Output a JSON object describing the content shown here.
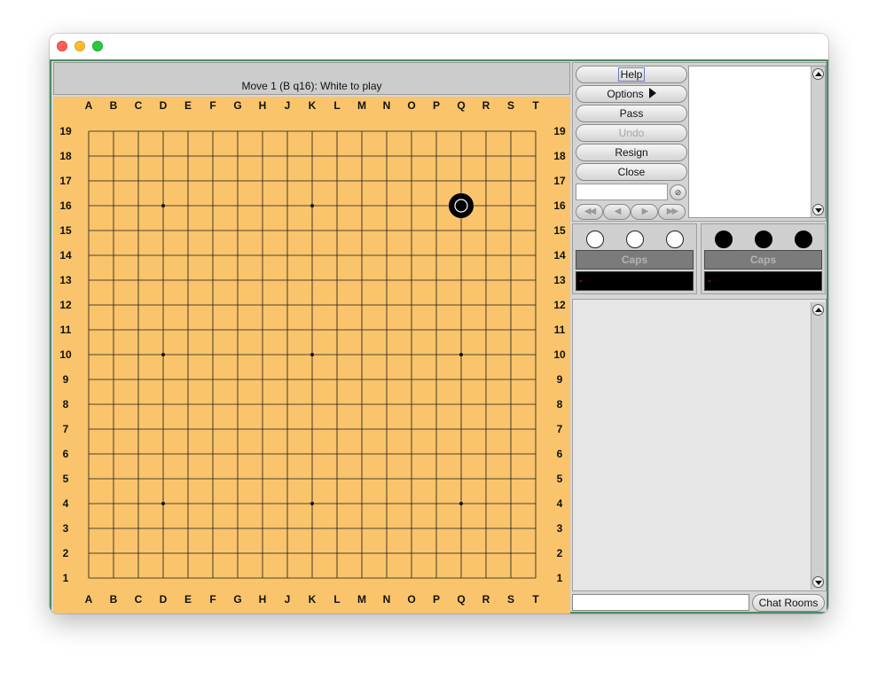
{
  "status": {
    "text": "Move 1 (B q16): White to play"
  },
  "board": {
    "size": 19,
    "columns": [
      "A",
      "B",
      "C",
      "D",
      "E",
      "F",
      "G",
      "H",
      "J",
      "K",
      "L",
      "M",
      "N",
      "O",
      "P",
      "Q",
      "R",
      "S",
      "T"
    ],
    "rows": [
      "19",
      "18",
      "17",
      "16",
      "15",
      "14",
      "13",
      "12",
      "11",
      "10",
      "9",
      "8",
      "7",
      "6",
      "5",
      "4",
      "3",
      "2",
      "1"
    ],
    "background_color": "#f9c46b",
    "star_points": [
      "D16",
      "K16",
      "Q16",
      "D10",
      "K10",
      "Q10",
      "D4",
      "K4",
      "Q4"
    ],
    "stones": [
      {
        "color": "black",
        "point": "Q16",
        "last_move": true
      }
    ]
  },
  "controls": {
    "help": "Help",
    "options": "Options",
    "pass": "Pass",
    "undo": "Undo",
    "resign": "Resign",
    "close": "Close",
    "move_input_value": "",
    "nav": {
      "first": "◀◀",
      "prev": "◀",
      "next": "▶",
      "last": "▶▶"
    }
  },
  "players": {
    "white": {
      "caps_label": "Caps",
      "caps_value": "-"
    },
    "black": {
      "caps_label": "Caps",
      "caps_value": "-"
    }
  },
  "chat": {
    "input_value": "",
    "rooms_button": "Chat Rooms"
  }
}
